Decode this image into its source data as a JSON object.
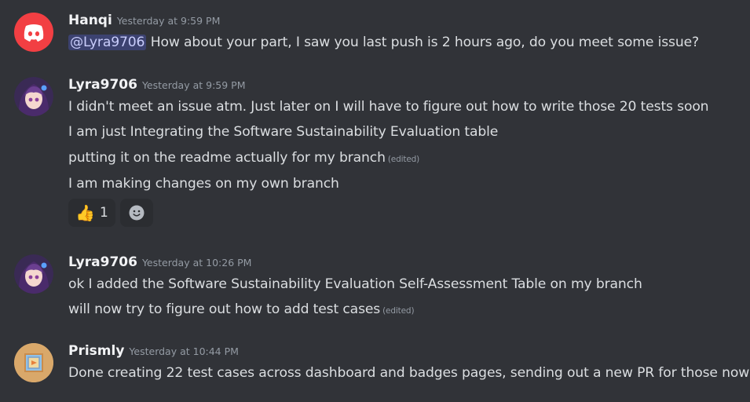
{
  "messages": [
    {
      "username": "Hanqi",
      "timestamp": "Yesterday at 9:59 PM",
      "avatar_icon": "discord-logo-icon",
      "avatar_color": "#f23f43",
      "mention": "@Lyra9706",
      "lines": [
        "How about your part, I saw you last push is 2 hours ago, do you meet some issue?"
      ]
    },
    {
      "username": "Lyra9706",
      "timestamp": "Yesterday at 9:59 PM",
      "avatar_icon": "anime-girl-avatar-icon",
      "lines": [
        "I didn't meet an issue atm. Just later on I will have to figure out how to write those 20 tests soon",
        "I am just Integrating the Software Sustainability Evaluation table",
        "putting it on the readme actually for my branch",
        "I am making changes on my own branch"
      ],
      "edited_label": "(edited)",
      "reactions": [
        {
          "icon": "thumbs-up-icon",
          "emoji": "👍",
          "count": "1"
        },
        {
          "icon": "add-reaction-icon"
        }
      ]
    },
    {
      "username": "Lyra9706",
      "timestamp": "Yesterday at 10:26 PM",
      "avatar_icon": "anime-girl-avatar-icon",
      "lines": [
        "ok I added the Software Sustainability Evaluation Self-Assessment Table on my branch",
        "will now try to figure out how to add test cases"
      ],
      "edited_label": "(edited)"
    },
    {
      "username": "Prismly",
      "timestamp": "Yesterday at 10:44 PM",
      "avatar_icon": "framed-picture-avatar-icon",
      "lines": [
        "Done creating 22 test cases across dashboard and badges pages, sending out a new PR for those now"
      ]
    }
  ]
}
